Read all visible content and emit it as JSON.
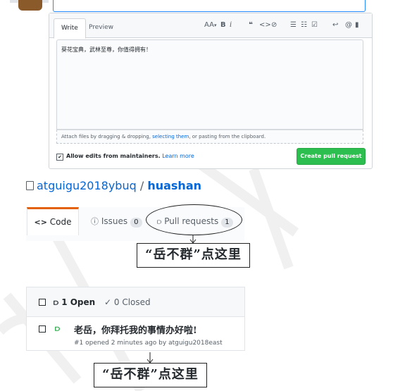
{
  "editor": {
    "tab_write": "Write",
    "tab_preview": "Preview",
    "toolbar": {
      "heading": "AA",
      "bold": "B",
      "italic": "i",
      "quote": "❝",
      "code": "<>",
      "link": "⊘",
      "ul": "☰",
      "ol": "☷",
      "tasks": "☑",
      "reply": "↩",
      "mention": "@",
      "bookmark": "▮"
    },
    "body_text": "葵花宝典，武林至尊，你值得拥有！",
    "attach_prefix": "Attach files by dragging & dropping, ",
    "attach_link": "selecting them",
    "attach_suffix": ", or pasting from the clipboard.",
    "allow_edits_label": "Allow edits from maintainers.",
    "learn_more": "Learn more",
    "create_button": "Create pull request"
  },
  "repo": {
    "owner": "atguigu2018ybuq",
    "separator": " / ",
    "name": "huashan"
  },
  "nav": {
    "code_label": "Code",
    "issues_label": "Issues",
    "issues_count": "0",
    "pulls_label": "Pull requests",
    "pulls_count": "1"
  },
  "annotations": {
    "callout_1": "“岳不群”点这里",
    "callout_2": "“岳不群”点这里"
  },
  "pr_list": {
    "open_count": "1 Open",
    "closed_count": "0 Closed",
    "items": [
      {
        "title": "老岳，你拜托我的事情办好啦!",
        "meta": "#1 opened 2 minutes ago by atguigu2018east"
      }
    ]
  },
  "colors": {
    "accent_blue": "#0366d6",
    "create_green": "#2cbe4e",
    "code_tab_orange": "#e36209"
  }
}
